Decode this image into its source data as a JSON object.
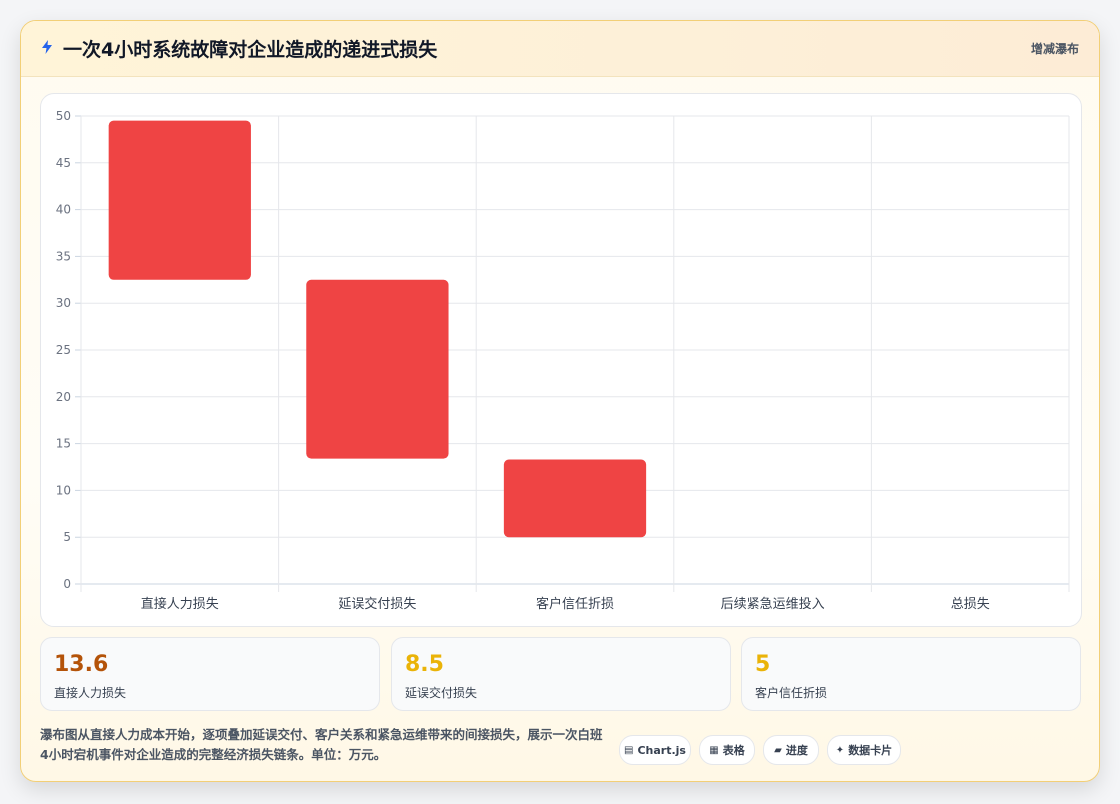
{
  "header": {
    "icon": "lightning-icon",
    "title": "一次4小时系统故障对企业造成的递进式损失",
    "chart_type_label": "增减瀑布"
  },
  "colors": {
    "bar": "#ef4444",
    "kpi_1": "#b45309",
    "kpi_2": "#eab308",
    "kpi_3": "#eab308",
    "card_border": "#f2cf77"
  },
  "chart_data": {
    "type": "bar",
    "subtype": "waterfall",
    "categories": [
      "直接人力损失",
      "延误交付损失",
      "客户信任折损",
      "后续紧急运维投入",
      "总损失"
    ],
    "series": [
      {
        "ranges": [
          [
            32.5,
            49.5
          ],
          [
            13.4,
            32.5
          ],
          [
            5,
            13.3
          ],
          null,
          null
        ]
      }
    ],
    "yticks": [
      0,
      5,
      10,
      15,
      20,
      25,
      30,
      35,
      40,
      45,
      50
    ],
    "ylim": [
      0,
      50
    ],
    "xlabel": "",
    "ylabel": "",
    "grid": true
  },
  "kpis": [
    {
      "value": "13.6",
      "label": "直接人力损失"
    },
    {
      "value": "8.5",
      "label": "延误交付损失"
    },
    {
      "value": "5",
      "label": "客户信任折损"
    }
  ],
  "description": "瀑布图从直接人力成本开始，逐项叠加延误交付、客户关系和紧急运维带来的间接损失，展示一次白班4小时宕机事件对企业造成的完整经济损失链条。单位：万元。",
  "tags": [
    {
      "icon": "chart-icon",
      "glyph": "▤",
      "label": "Chart.js"
    },
    {
      "icon": "table-icon",
      "glyph": "▦",
      "label": "表格"
    },
    {
      "icon": "progress-icon",
      "glyph": "▰",
      "label": "进度"
    },
    {
      "icon": "card-icon",
      "glyph": "✦",
      "label": "数据卡片"
    }
  ]
}
